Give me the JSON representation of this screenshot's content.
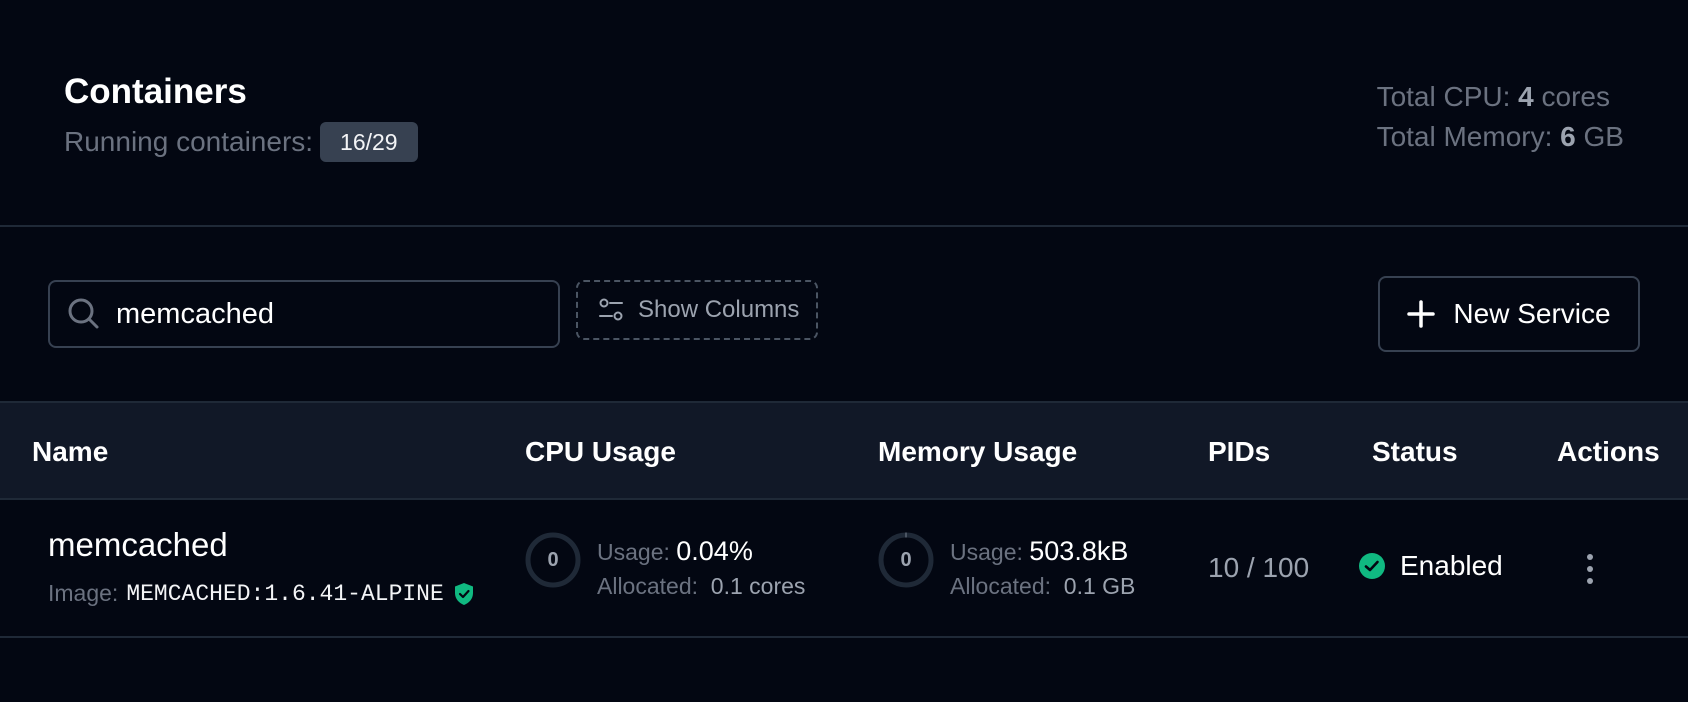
{
  "header": {
    "title": "Containers",
    "running_label": "Running containers:",
    "running_count": "16/29",
    "cpu_label": "Total CPU:",
    "cpu_value": "4",
    "cpu_unit": "cores",
    "mem_label": "Total Memory:",
    "mem_value": "6",
    "mem_unit": "GB"
  },
  "toolbar": {
    "search_value": "memcached",
    "show_columns_label": "Show Columns",
    "new_service_label": "New Service"
  },
  "table": {
    "columns": [
      "Name",
      "CPU Usage",
      "Memory Usage",
      "PIDs",
      "Status",
      "Actions"
    ],
    "rows": [
      {
        "name": "memcached",
        "image_label": "Image:",
        "image": "MEMCACHED:1.6.41-ALPINE",
        "cpu_gauge": "0",
        "cpu_usage_label": "Usage:",
        "cpu_usage": "0.04%",
        "cpu_alloc_label": "Allocated:",
        "cpu_alloc": "0.1 cores",
        "mem_gauge": "0",
        "mem_usage_label": "Usage:",
        "mem_usage": "503.8kB",
        "mem_alloc_label": "Allocated:",
        "mem_alloc": "0.1 GB",
        "pids": "10 / 100",
        "status": "Enabled"
      }
    ]
  },
  "icons": {
    "search": "search-icon",
    "columns": "sliders-icon",
    "new": "plus-icon",
    "verified": "shield-check-icon",
    "status": "check-circle-icon",
    "actions": "more-vertical-icon"
  },
  "colors": {
    "background": "#030712",
    "accent_green": "#10b981"
  }
}
